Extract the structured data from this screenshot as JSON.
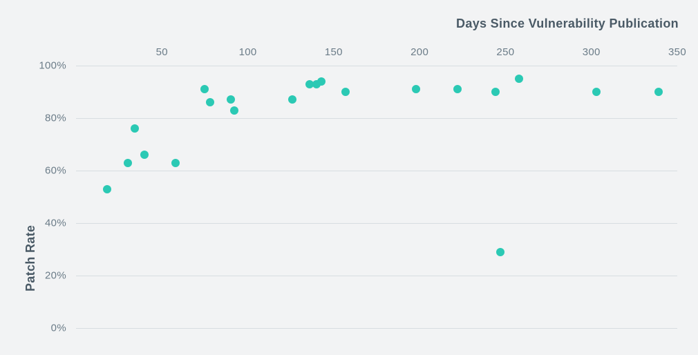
{
  "chart_data": {
    "type": "scatter",
    "title": "",
    "xlabel": "Days Since Vulnerability Publication",
    "ylabel": "Patch Rate",
    "xlim": [
      0,
      350
    ],
    "ylim": [
      0,
      100
    ],
    "y_tick_format_suffix": "%",
    "x_ticks": [
      50,
      100,
      150,
      200,
      250,
      300,
      350
    ],
    "y_ticks": [
      0,
      20,
      40,
      60,
      80,
      100
    ],
    "grid_y": true,
    "point_color": "#2bc9b4",
    "series": [
      {
        "name": "patch-rate",
        "points": [
          {
            "x": 18,
            "y": 53
          },
          {
            "x": 30,
            "y": 63
          },
          {
            "x": 34,
            "y": 76
          },
          {
            "x": 40,
            "y": 66
          },
          {
            "x": 58,
            "y": 63
          },
          {
            "x": 75,
            "y": 91
          },
          {
            "x": 78,
            "y": 86
          },
          {
            "x": 90,
            "y": 87
          },
          {
            "x": 92,
            "y": 83
          },
          {
            "x": 126,
            "y": 87
          },
          {
            "x": 136,
            "y": 93
          },
          {
            "x": 140,
            "y": 93
          },
          {
            "x": 143,
            "y": 94
          },
          {
            "x": 157,
            "y": 90
          },
          {
            "x": 198,
            "y": 91
          },
          {
            "x": 222,
            "y": 91
          },
          {
            "x": 244,
            "y": 90
          },
          {
            "x": 247,
            "y": 29
          },
          {
            "x": 258,
            "y": 95
          },
          {
            "x": 303,
            "y": 90
          },
          {
            "x": 339,
            "y": 90
          }
        ]
      }
    ]
  }
}
